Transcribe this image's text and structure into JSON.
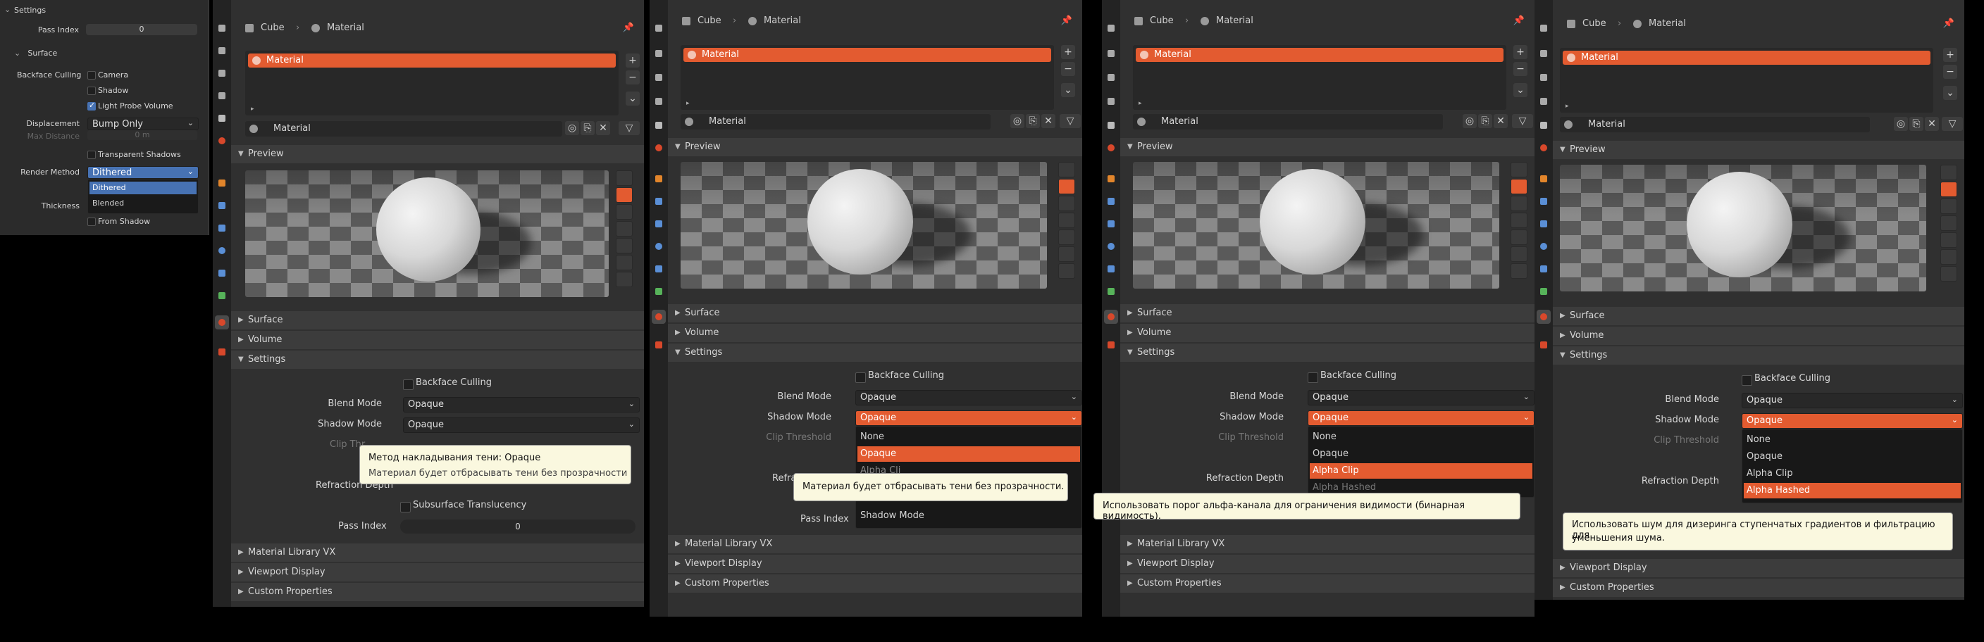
{
  "colors": {
    "accent": "#e35b30",
    "panel": "#303030",
    "header": "#3c3c3c",
    "tooltip": "#faf8df"
  },
  "left_panel": {
    "section_title": "Settings",
    "pass_index_label": "Pass Index",
    "pass_index_value": "0",
    "surface_title": "Surface",
    "backface_label": "Backface Culling",
    "camera_label": "Camera",
    "shadow_label": "Shadow",
    "light_probe_label": "Light Probe Volume",
    "displacement_label": "Displacement",
    "displacement_value": "Bump Only",
    "max_distance_label": "Max Distance",
    "max_distance_value": "0 m",
    "transparent_shadows_label": "Transparent Shadows",
    "render_method_label": "Render Method",
    "render_method_value": "Dithered",
    "options": [
      "Dithered",
      "Blended"
    ],
    "thickness_label": "Thickness",
    "from_shadow_label": "From Shadow"
  },
  "common": {
    "object": "Cube",
    "material_tab": "Material",
    "material_name": "Material",
    "preview": "Preview",
    "surface": "Surface",
    "volume": "Volume",
    "settings": "Settings",
    "backface_culling": "Backface Culling",
    "blend_mode_label": "Blend Mode",
    "blend_mode_value": "Opaque",
    "shadow_mode_label": "Shadow Mode",
    "shadow_mode_value": "Opaque",
    "clip_threshold_label": "Clip Threshold",
    "refraction_depth_label": "Refraction Depth",
    "subsurface_label": "Subsurface Translucency",
    "pass_index_label": "Pass Index",
    "pass_index_value": "0",
    "library": "Material Library VX",
    "viewport_display": "Viewport Display",
    "custom_properties": "Custom Properties"
  },
  "panel1": {
    "clip_partial": "Clip Thr",
    "refraction_partial": "Refraction Depth",
    "tooltip_title": "Метод накладывания тени:  Opaque",
    "tooltip_body": "Материал будет отбрасывать тени без прозрачности"
  },
  "panel2": {
    "menu": [
      "None",
      "Opaque",
      "Alpha Cli"
    ],
    "menu_hl": "Opaque",
    "menu_footer": "Shadow Mode",
    "refraction_partial": "Refractio",
    "pass_partial": "Pass Index",
    "tooltip": "Материал будет отбрасывать тени без прозрачности."
  },
  "panel3": {
    "menu": [
      "None",
      "Opaque",
      "Alpha Clip",
      "Alpha Hashed"
    ],
    "menu_hl": "Alpha Clip",
    "tooltip": "Использовать порог альфа-канала для ограничения видимости (бинарная видимость)."
  },
  "panel4": {
    "menu": [
      "None",
      "Opaque",
      "Alpha Clip",
      "Alpha Hashed"
    ],
    "menu_hl": "Alpha Hashed",
    "tooltip_line1": "Использовать шум для дизеринга ступенчатых градиентов и фильтрацию для",
    "tooltip_line2": "уменьшения шума."
  }
}
